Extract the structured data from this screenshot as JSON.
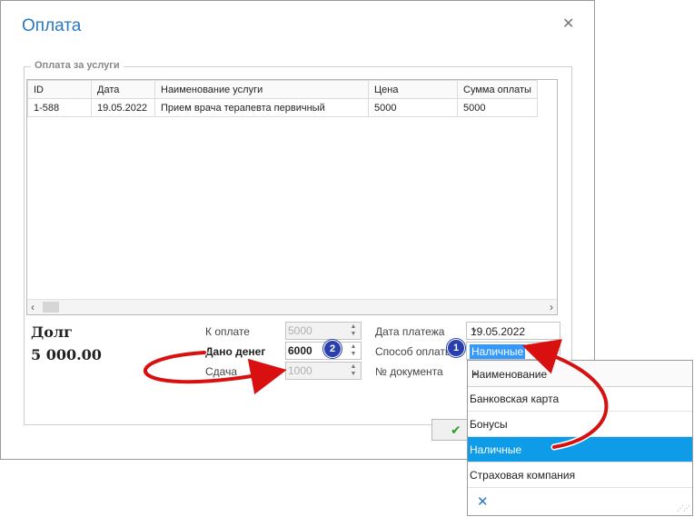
{
  "dialog": {
    "title": "Оплата"
  },
  "group": {
    "label": "Оплата за услуги"
  },
  "grid": {
    "columns": [
      "ID",
      "Дата",
      "Наименование услуги",
      "Цена",
      "Сумма оплаты"
    ],
    "rows": [
      [
        "1-588",
        "19.05.2022",
        "Прием врача терапевта первичный",
        "5000",
        "5000"
      ]
    ]
  },
  "debt": {
    "label": "Долг",
    "amount": "5 000.00"
  },
  "form": {
    "to_pay_label": "К оплате",
    "to_pay_value": "5000",
    "given_label": "Дано денег",
    "given_value": "6000",
    "change_label": "Сдача",
    "change_value": "1000",
    "date_label": "Дата платежа",
    "date_value": "19.05.2022",
    "method_label": "Способ оплаты",
    "method_value": "Наличные",
    "doc_label": "№ документа"
  },
  "dropdown": {
    "header": "Наименование",
    "items": [
      "Банковская карта",
      "Бонусы",
      "Наличные",
      "Страховая компания"
    ],
    "selected": "Наличные"
  },
  "badges": [
    "1",
    "2"
  ],
  "colors": {
    "accent": "#2b78c2",
    "selection": "#0e9ce8",
    "arrow": "#d81010",
    "badge": "#2a3fae"
  },
  "icons": {
    "close": "close-icon",
    "ok": "check-icon",
    "clear": "clear-icon"
  }
}
